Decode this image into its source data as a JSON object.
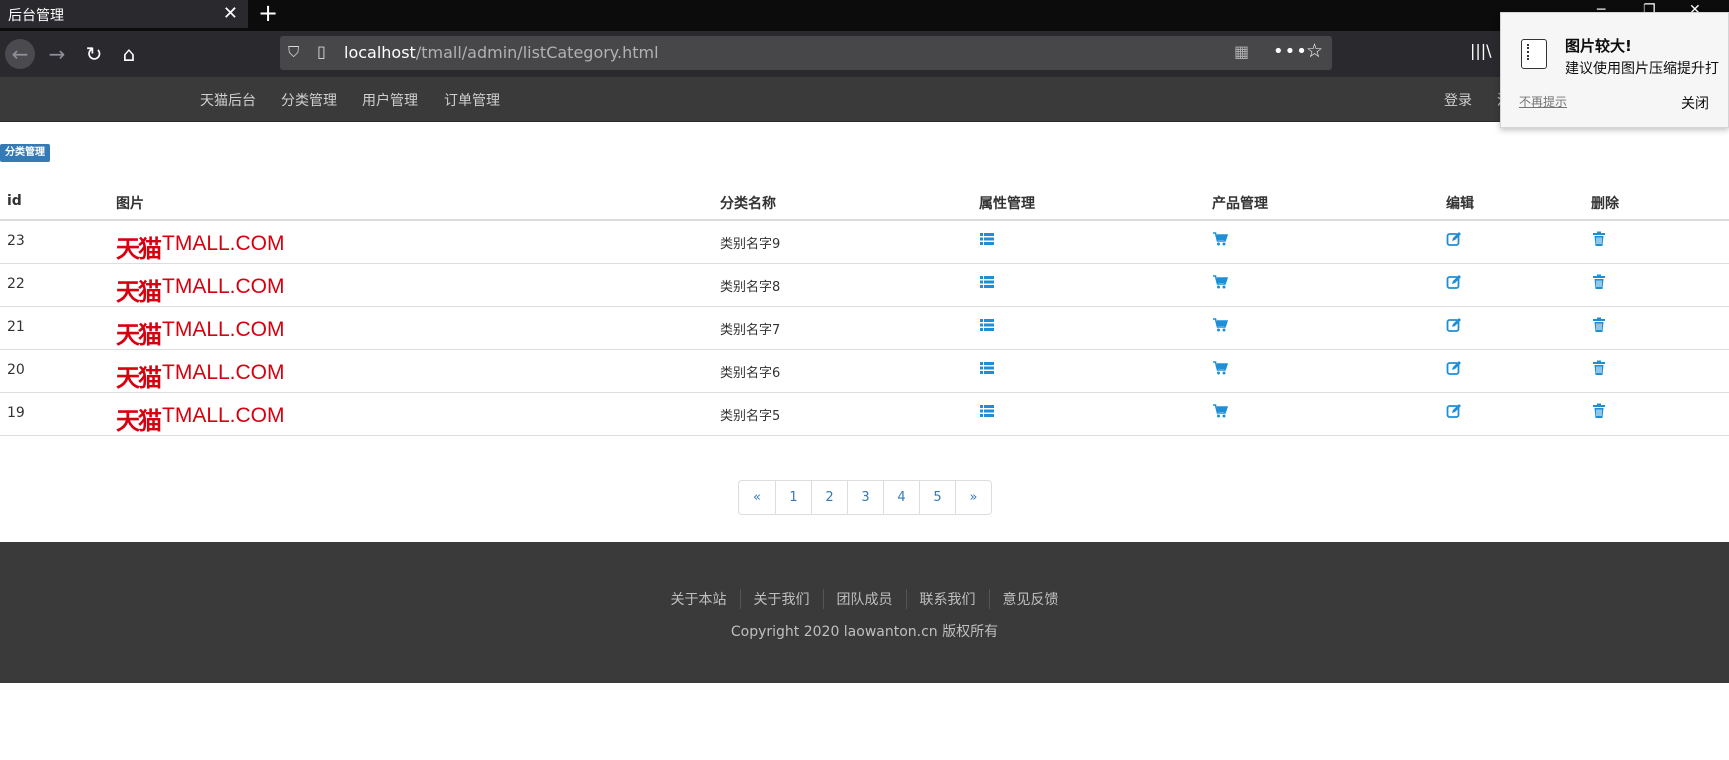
{
  "browser": {
    "tab_title": "后台管理",
    "tab_close": "✕",
    "new_tab": "+",
    "url_host": "localhost",
    "url_path": "/tmall/admin/listCategory.html"
  },
  "site_nav": {
    "items": [
      "天猫后台",
      "分类管理",
      "用户管理",
      "订单管理"
    ],
    "login": "登录",
    "register": "注"
  },
  "notification": {
    "title": "图片较大!",
    "message": "建议使用图片压缩提升打",
    "dont_show": "不再提示",
    "close": "关闭"
  },
  "badge": "分类管理",
  "table": {
    "headers": [
      "id",
      "图片",
      "分类名称",
      "属性管理",
      "产品管理",
      "编辑",
      "删除"
    ],
    "logo_cn": "天猫",
    "logo_en": "TMALL.COM",
    "rows": [
      {
        "id": "23",
        "name": "类别名字9"
      },
      {
        "id": "22",
        "name": "类别名字8"
      },
      {
        "id": "21",
        "name": "类别名字7"
      },
      {
        "id": "20",
        "name": "类别名字6"
      },
      {
        "id": "19",
        "name": "类别名字5"
      }
    ]
  },
  "pagination": [
    "«",
    "1",
    "2",
    "3",
    "4",
    "5",
    "»"
  ],
  "footer": {
    "links": [
      "关于本站",
      "关于我们",
      "团队成员",
      "联系我们",
      "意见反馈"
    ],
    "copyright": "Copyright 2020 laowanton.cn 版权所有"
  },
  "colors": {
    "accent": "#1e8fd6",
    "badge": "#337ab7",
    "dark_bar": "#3a3a3a",
    "logo_red": "#d7000f"
  }
}
